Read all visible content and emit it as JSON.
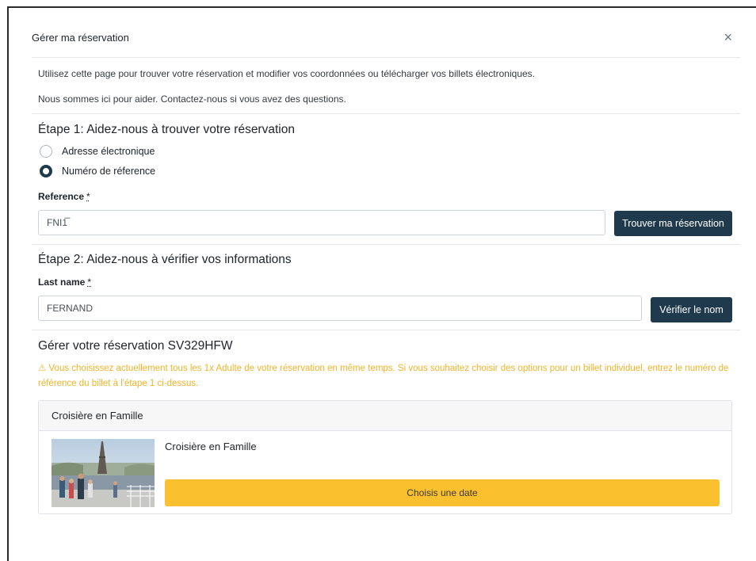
{
  "modal": {
    "title": "Gérer ma réservation",
    "close_symbol": "×",
    "intro_1": "Utilisez cette page pour trouver votre réservation et modifier vos coordonnées ou télécharger vos billets électroniques.",
    "intro_2": "Nous sommes ici pour aider. Contactez-nous si vous avez des questions."
  },
  "step1": {
    "heading": "Étape 1: Aidez-nous à trouver votre réservation",
    "options": [
      {
        "label": "Adresse électronique",
        "checked": false
      },
      {
        "label": "Numéro de réference",
        "checked": true
      }
    ],
    "field_label": "Reference",
    "required_mark": "*",
    "field_value": "FNI1̅",
    "button_label": "Trouver ma réservation"
  },
  "step2": {
    "heading": "Étape 2: Aidez-nous à vérifier vos informations",
    "field_label": "Last name",
    "required_mark": "*",
    "field_value": "FERNAND",
    "button_label": "Vérifier le nom"
  },
  "manage": {
    "heading": "Gérer votre réservation SV329HFW",
    "warning_icon": "warning-triangle-icon",
    "warning_symbol": "⚠",
    "warning_text": "Vous choisissez actuellement tous les 1x Adulte de votre réservation en même temps. Si vous souhaitez choisir des options pour un billet individuel, entrez le numéro de référence du billet à l'étape 1 ci-dessus.",
    "card": {
      "header": "Croisière en Famille",
      "title": "Croisière en Famille",
      "button_label": "Choisis une date"
    }
  },
  "colors": {
    "primary": "#1f3a4d",
    "warning": "#f0b429",
    "cta": "#fbc02d"
  }
}
